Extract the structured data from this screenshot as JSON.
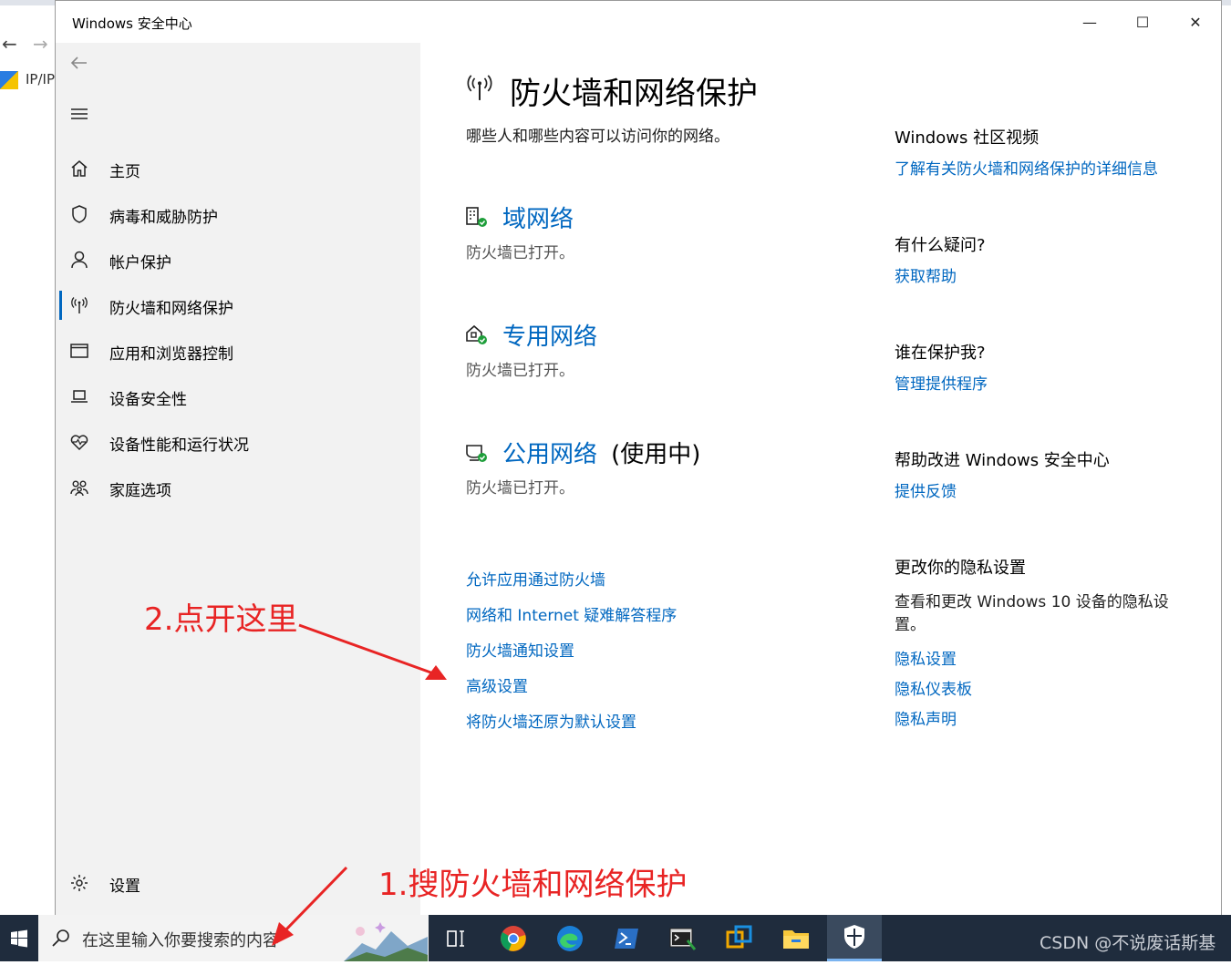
{
  "window": {
    "title": "Windows 安全中心",
    "controls": {
      "minimize": "—",
      "maximize": "☐",
      "close": "✕"
    }
  },
  "sidebar": {
    "items": [
      {
        "label": "主页",
        "icon": "home-icon"
      },
      {
        "label": "病毒和威胁防护",
        "icon": "shield-icon"
      },
      {
        "label": "帐户保护",
        "icon": "person-icon"
      },
      {
        "label": "防火墙和网络保护",
        "icon": "network-antenna-icon",
        "active": true
      },
      {
        "label": "应用和浏览器控制",
        "icon": "app-window-icon"
      },
      {
        "label": "设备安全性",
        "icon": "laptop-icon"
      },
      {
        "label": "设备性能和运行状况",
        "icon": "heart-icon"
      },
      {
        "label": "家庭选项",
        "icon": "family-icon"
      }
    ],
    "settings_label": "设置"
  },
  "main": {
    "title": "防火墙和网络保护",
    "subtitle": "哪些人和哪些内容可以访问你的网络。",
    "networks": [
      {
        "name": "域网络",
        "status": "防火墙已打开。",
        "suffix": ""
      },
      {
        "name": "专用网络",
        "status": "防火墙已打开。",
        "suffix": ""
      },
      {
        "name": "公用网络",
        "status": "防火墙已打开。",
        "suffix": "(使用中)"
      }
    ],
    "links": [
      "允许应用通过防火墙",
      "网络和 Internet 疑难解答程序",
      "防火墙通知设置",
      "高级设置",
      "将防火墙还原为默认设置"
    ]
  },
  "right": {
    "sections": [
      {
        "heading": "Windows 社区视频",
        "links": [
          "了解有关防火墙和网络保护的详细信息"
        ]
      },
      {
        "heading": "有什么疑问?",
        "links": [
          "获取帮助"
        ]
      },
      {
        "heading": "谁在保护我?",
        "links": [
          "管理提供程序"
        ]
      },
      {
        "heading": "帮助改进 Windows 安全中心",
        "links": [
          "提供反馈"
        ]
      }
    ],
    "privacy": {
      "heading": "更改你的隐私设置",
      "text": "查看和更改 Windows 10 设备的隐私设置。",
      "links": [
        "隐私设置",
        "隐私仪表板",
        "隐私声明"
      ]
    }
  },
  "taskbar": {
    "search_placeholder": "在这里输入你要搜索的内容",
    "watermark": "CSDN @不说废话斯基"
  },
  "annotations": {
    "step1": "1.搜防火墙和网络保护",
    "step2": "2.点开这里"
  },
  "colors": {
    "accent": "#0067c0",
    "annotation": "#e82424",
    "sidebar_bg": "#f2f2f2",
    "taskbar_bg": "#1f2c3d"
  }
}
